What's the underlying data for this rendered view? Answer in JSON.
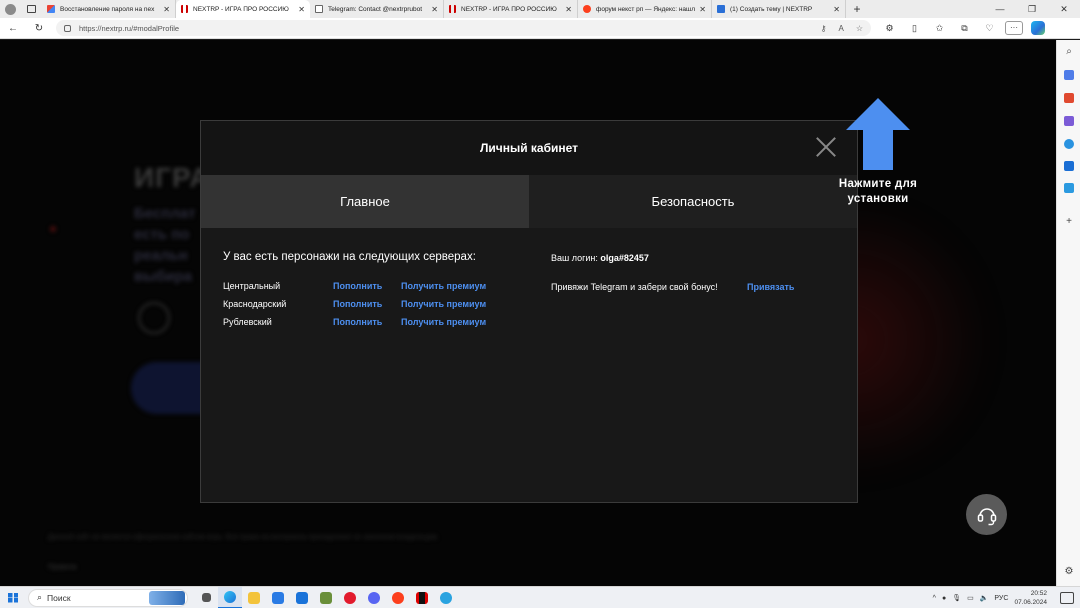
{
  "browser": {
    "tabs": [
      {
        "title": "Восстановление пароля на nex",
        "favicon": "gmail-icon",
        "active": false
      },
      {
        "title": "NEXTRP - ИГРА ПРО РОССИЮ",
        "favicon": "netflix-icon",
        "active": true
      },
      {
        "title": "Telegram: Contact @nextrprubot",
        "favicon": "document-icon",
        "active": false
      },
      {
        "title": "NEXTRP - ИГРА ПРО РОССИЮ",
        "favicon": "netflix-icon",
        "active": false
      },
      {
        "title": "форум некст рп — Яндекс: нашл",
        "favicon": "yandex-icon",
        "active": false
      },
      {
        "title": "(1) Создать тему | NEXTRP",
        "favicon": "teams-icon",
        "active": false
      }
    ],
    "new_tab": "+",
    "url": "https://nextrp.ru/#modalProfile",
    "window_controls": {
      "minimize": "—",
      "maximize": "❐",
      "close": "✕"
    }
  },
  "page_bg": {
    "title": "ИГРА",
    "lines": [
      "Бесплат",
      "есть по",
      "реальн",
      "выбира"
    ],
    "footer": "Данный сайт не является официальным сайтом игры. Все права на материалы принадлежат их законным владельцам.",
    "footer_link": "Правила"
  },
  "modal": {
    "title": "Личный кабинет",
    "tabs": [
      {
        "label": "Главное",
        "active": true
      },
      {
        "label": "Безопасность",
        "active": false
      }
    ],
    "servers_title": "У вас есть персонажи на следующих серверах:",
    "servers": [
      {
        "name": "Центральный",
        "topup": "Пополнить",
        "premium": "Получить премиум"
      },
      {
        "name": "Краснодарский",
        "topup": "Пополнить",
        "premium": "Получить премиум"
      },
      {
        "name": "Рублевский",
        "topup": "Пополнить",
        "premium": "Получить премиум"
      }
    ],
    "login_label": "Ваш логин:",
    "login_value": "olga#82457",
    "telegram_text": "Привяжи Telegram и забери свой бонус!",
    "telegram_link": "Привязать"
  },
  "install_hint": {
    "line1": "Нажмите для",
    "line2": "установки"
  },
  "colors": {
    "link": "#4d8ff0",
    "arrow": "#4d8ff0",
    "modal_bg": "#181818"
  },
  "taskbar": {
    "search_placeholder": "Поиск",
    "lang": "РУС",
    "time": "20:52",
    "date": "07.06.2024"
  }
}
